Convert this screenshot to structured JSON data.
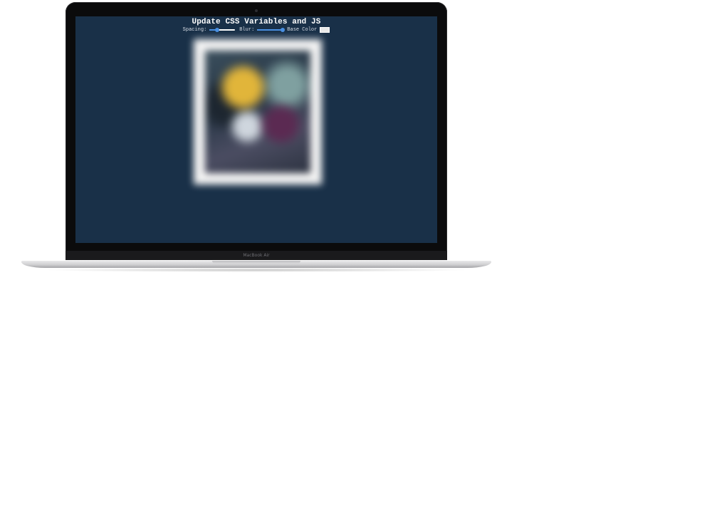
{
  "device": {
    "model_label": "MacBook Air"
  },
  "page": {
    "title": "Update CSS Variables and JS",
    "controls": {
      "spacing": {
        "label": "Spacing:",
        "value_fraction": 0.3
      },
      "blur": {
        "label": "Blur:",
        "value_fraction": 1.0
      },
      "base_color": {
        "label": "Base Color",
        "value": "#e8e8e8"
      }
    }
  },
  "colors": {
    "screen_background": "#193048",
    "accent": "#4a90e2"
  }
}
